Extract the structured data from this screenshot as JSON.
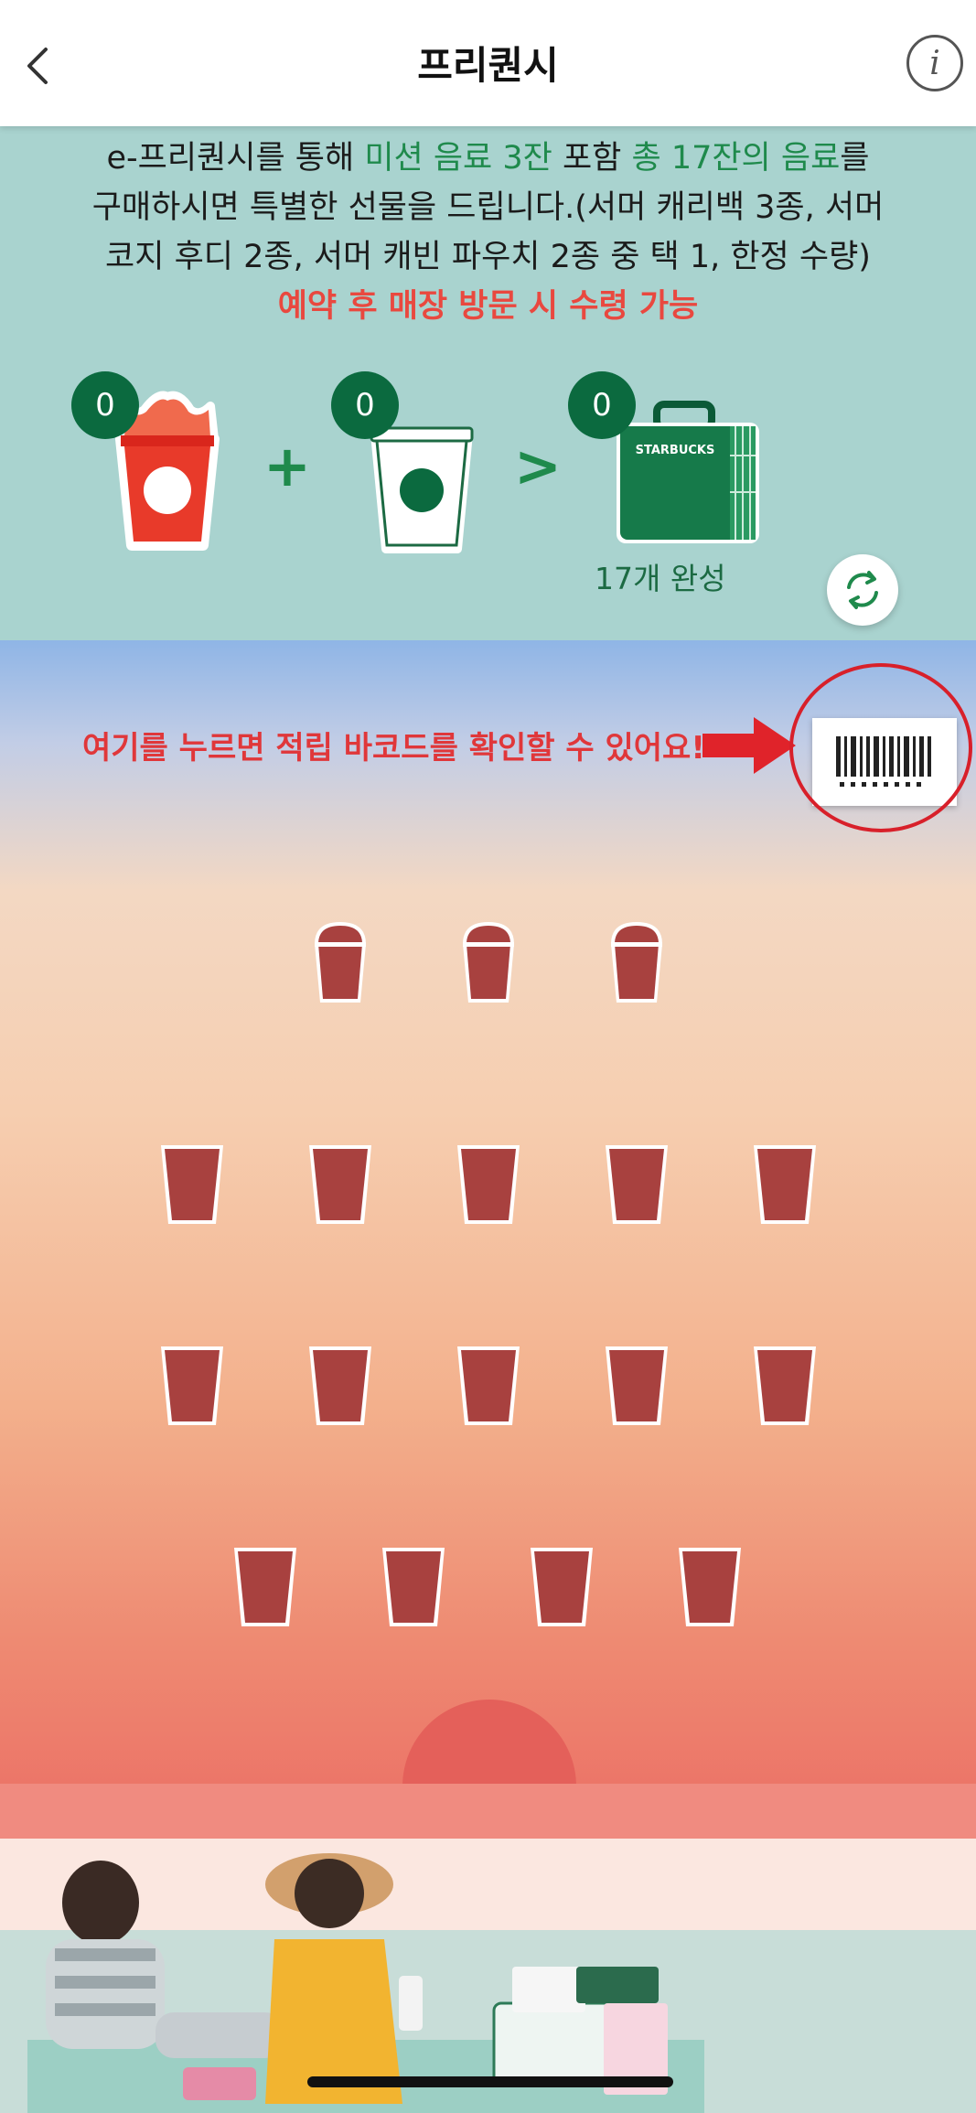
{
  "header": {
    "title": "프리퀀시",
    "back_icon": "chevron-left-icon",
    "info_icon": "info-icon",
    "info_label": "i"
  },
  "promo": {
    "line1_pre": "e-프리퀀시를 통해 ",
    "line1_hl1": "미션 음료 3잔",
    "line1_mid": " 포함 ",
    "line1_hl2": "총 17잔의 음료",
    "line1_post": "를",
    "line2": "구매하시면 특별한 선물을 드립니다.(서머 캐리백 3종, 서머",
    "line3": "코지 후디 2종, 서머 캐빈 파우치 2종 중 택 1, 한정 수량)",
    "notice": "예약 후 매장 방문 시 수령 가능",
    "mission_count": "0",
    "regular_count": "0",
    "completed_count": "0",
    "plus": "+",
    "arrow": ">",
    "complete_label": "17개 완성",
    "refresh_icon": "refresh-icon",
    "brand_text": "STARBUCKS"
  },
  "barcode": {
    "hint": "여기를 누르면 적립 바코드를 확인할 수 있어요!",
    "icon": "barcode-icon"
  },
  "stamps": {
    "mission_slots": 3,
    "regular_slots": 14,
    "collected": 0
  },
  "colors": {
    "green": "#1f8a4c",
    "dark_green": "#0b6a3f",
    "red": "#e9483f",
    "cup_empty": "#a8413f"
  }
}
